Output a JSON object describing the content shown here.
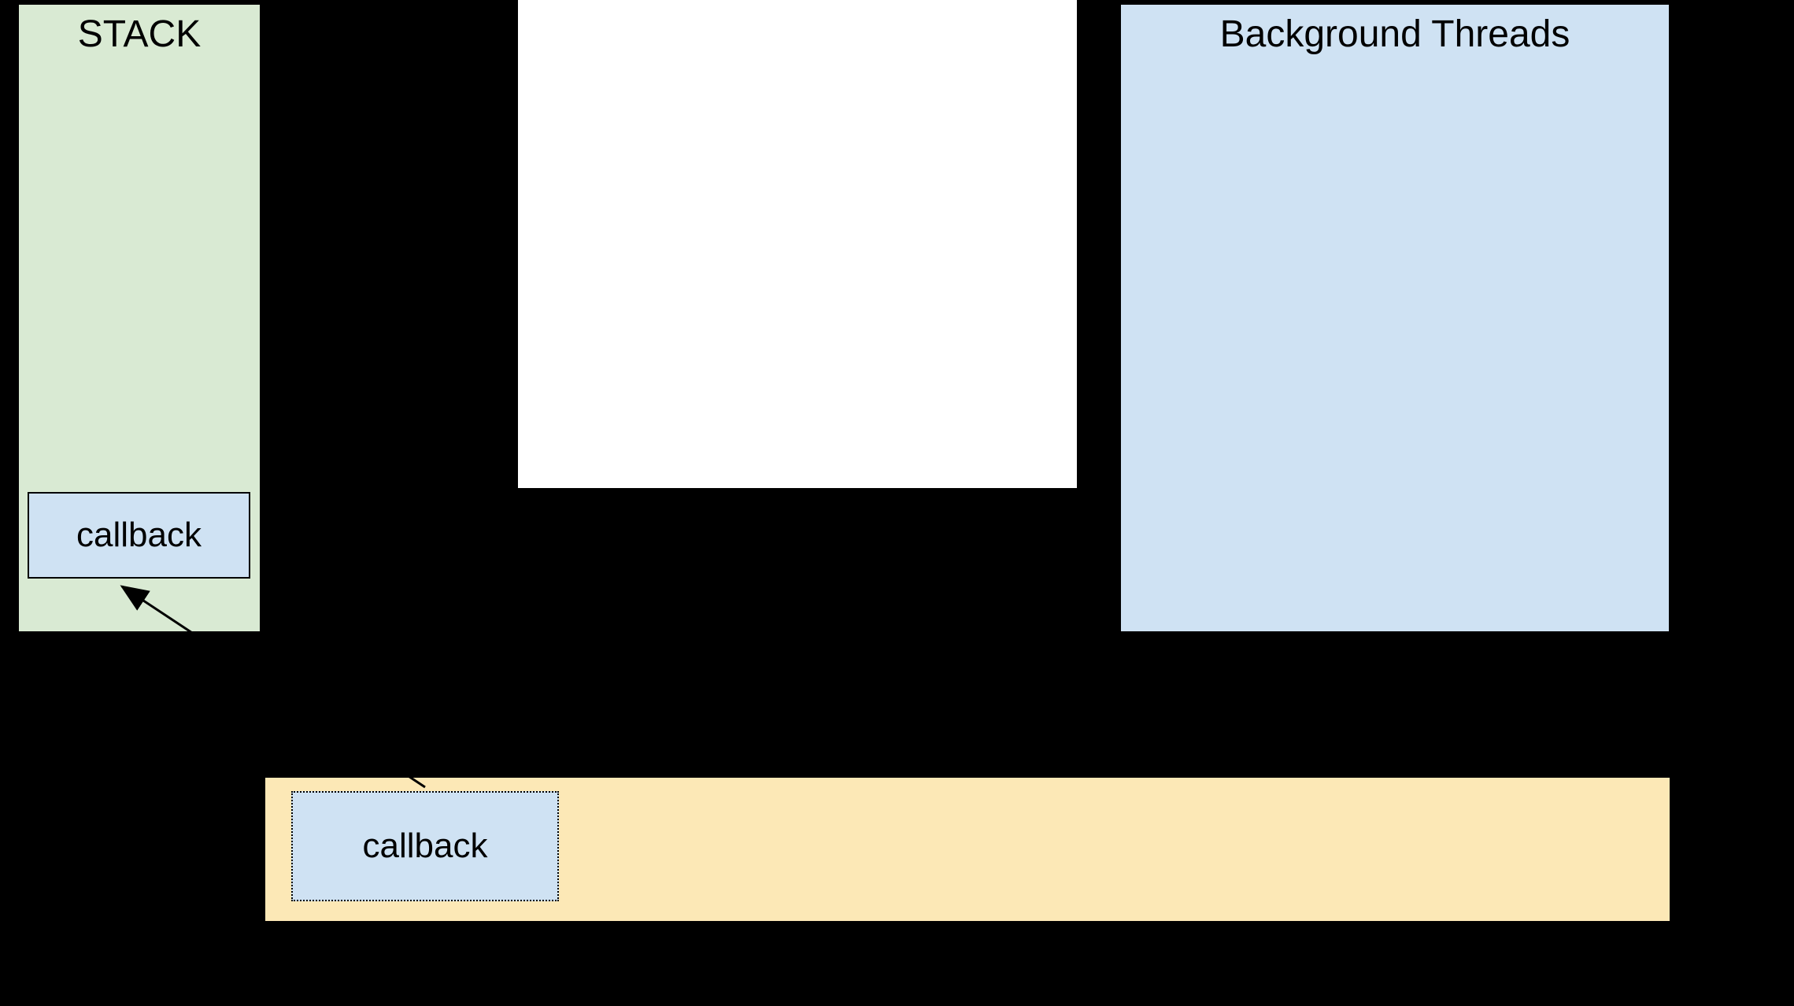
{
  "stack": {
    "title": "STACK"
  },
  "bgthreads": {
    "title": "Background Threads"
  },
  "callback_solid": {
    "label": "callback"
  },
  "callback_dotted": {
    "label": "callback"
  }
}
